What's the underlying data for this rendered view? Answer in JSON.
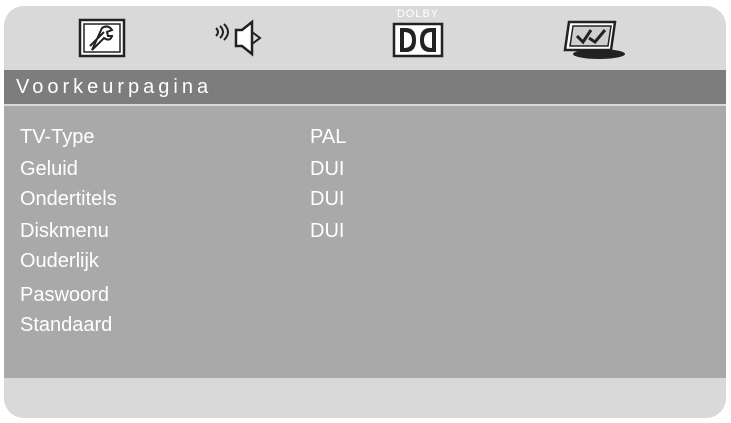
{
  "tabs": {
    "general_icon": "wrench-icon",
    "audio_icon": "speaker-icon",
    "dolby_icon": "dolby-icon",
    "dolby_label": "DOLBY",
    "preference_icon": "checkmark-panel-icon"
  },
  "page": {
    "title": "Voorkeurpagina"
  },
  "menu": {
    "items": [
      {
        "label": "TV-Type",
        "value": "PAL"
      },
      {
        "label": "Geluid",
        "value": "DUI"
      },
      {
        "label": "Ondertitels",
        "value": "DUI"
      },
      {
        "label": "Diskmenu",
        "value": "DUI"
      },
      {
        "label": "Ouderlijk",
        "value": ""
      },
      {
        "label": "Paswoord",
        "value": ""
      },
      {
        "label": "Standaard",
        "value": ""
      }
    ]
  },
  "colors": {
    "frame": "#d9d9d9",
    "title_bar": "#7d7d7d",
    "panel": "#a9a9a9",
    "text": "#ffffff"
  }
}
